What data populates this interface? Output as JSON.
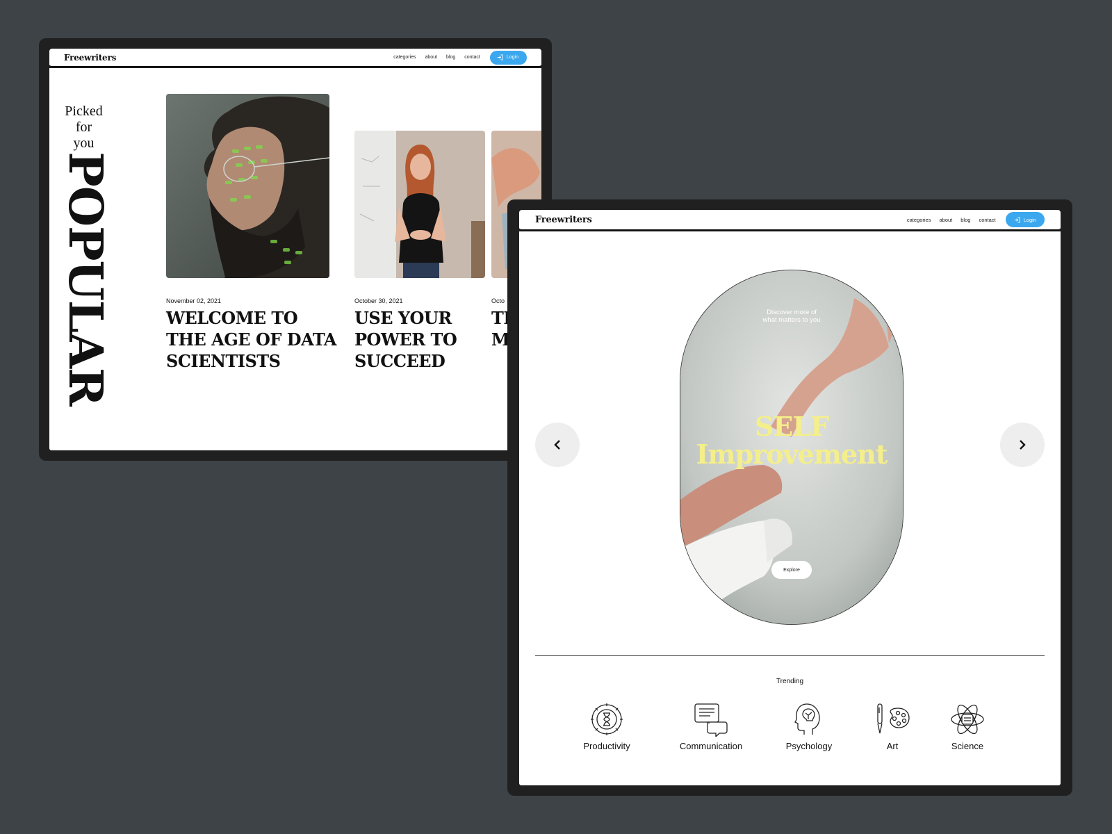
{
  "popular_page": {
    "brand": "Freewriters",
    "nav": [
      "categories",
      "about",
      "blog",
      "contact"
    ],
    "login_label": "Login",
    "picked_line1": "Picked",
    "picked_line2": "for you",
    "section_title": "POPULAR",
    "cards": [
      {
        "date": "November 02, 2021",
        "title_lines": [
          "WELCOME TO",
          "THE AGE OF DATA",
          "SCIENTISTS"
        ]
      },
      {
        "date": "October 30, 2021",
        "title_lines": [
          "USE YOUR",
          "POWER TO",
          "SUCCEED"
        ]
      },
      {
        "date": "Octo",
        "title_lines": [
          "TI",
          "M"
        ]
      }
    ]
  },
  "hero_page": {
    "brand": "Freewriters",
    "nav": [
      "categories",
      "about",
      "blog",
      "contact"
    ],
    "login_label": "Login",
    "hero_sub_line1": "Discover more of",
    "hero_sub_line2": "what matters to you",
    "hero_title_line1": "SELF",
    "hero_title_line2": "Improvement",
    "explore_label": "Explore",
    "trending_label": "Trending",
    "categories": [
      {
        "label": "Productivity",
        "icon": "hourglass-gear-icon"
      },
      {
        "label": "Communication",
        "icon": "chat-bubbles-icon"
      },
      {
        "label": "Psychology",
        "icon": "head-brain-icon"
      },
      {
        "label": "Art",
        "icon": "palette-brush-icon"
      },
      {
        "label": "Science",
        "icon": "atom-icon"
      }
    ]
  },
  "colors": {
    "background": "#3d4346",
    "frame": "#202020",
    "accent": "#3aa7ee",
    "hero_title": "#f4ef8a"
  }
}
